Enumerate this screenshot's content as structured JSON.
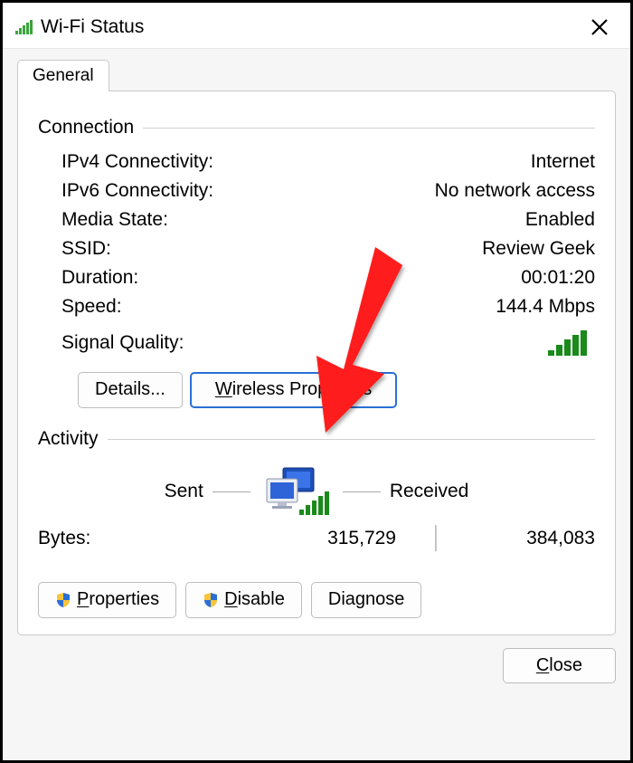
{
  "window": {
    "title": "Wi-Fi Status",
    "close_symbol": "✕"
  },
  "tabs": {
    "general": "General"
  },
  "connection": {
    "header": "Connection",
    "ipv4_label": "IPv4 Connectivity:",
    "ipv4_value": "Internet",
    "ipv6_label": "IPv6 Connectivity:",
    "ipv6_value": "No network access",
    "media_label": "Media State:",
    "media_value": "Enabled",
    "ssid_label": "SSID:",
    "ssid_value": "Review Geek",
    "duration_label": "Duration:",
    "duration_value": "00:01:20",
    "speed_label": "Speed:",
    "speed_value": "144.4 Mbps",
    "signal_label": "Signal Quality:"
  },
  "buttons": {
    "details": "Details...",
    "wireless_u": "W",
    "wireless_rest": "ireless Properties",
    "properties_u": "P",
    "properties_rest": "roperties",
    "disable_u": "D",
    "disable_rest": "isable",
    "diagnose": "Diagnose",
    "close_u": "C",
    "close_rest": "lose"
  },
  "activity": {
    "header": "Activity",
    "sent": "Sent",
    "received": "Received",
    "bytes_label": "Bytes:",
    "sent_value": "315,729",
    "received_value": "384,083"
  }
}
